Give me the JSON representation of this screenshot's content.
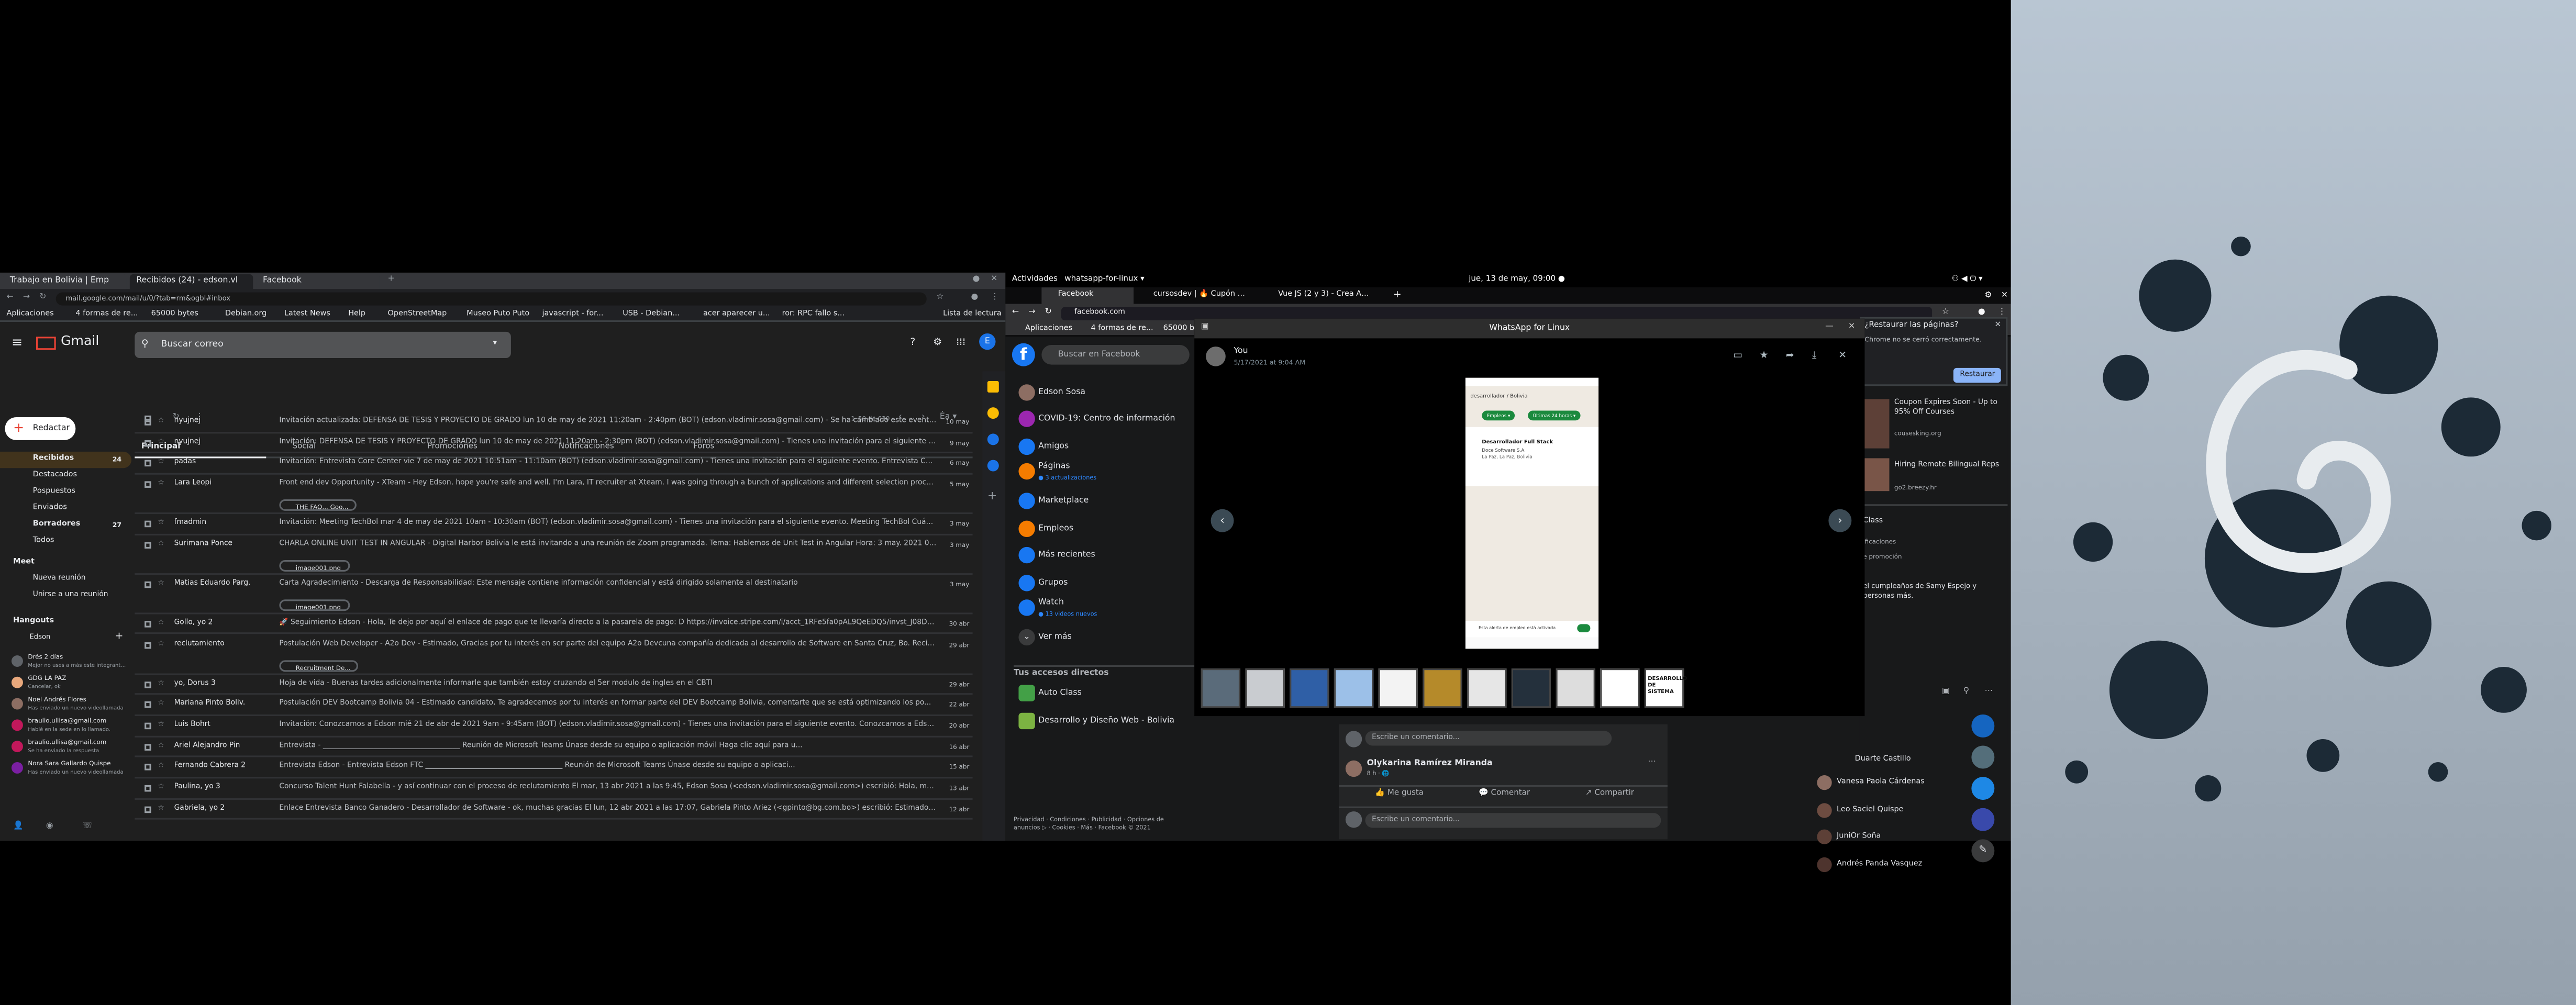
{
  "gmail_window": {
    "tabs": [
      "Trabajo en Bolivia | Emp",
      "Recibidos (24) - edson.vl",
      "Facebook"
    ],
    "url": "mail.google.com/mail/u/0/?tab=rm&ogbl#inbox",
    "bookmarks": [
      "Aplicaciones",
      "4 formas de re...",
      "65000 bytes",
      "Debian.org",
      "Latest News",
      "Help",
      "OpenStreetMap",
      "Museo Puto Puto",
      "javascript - for...",
      "USB - Debian...",
      "acer aparecer u...",
      "ror: RPC fallo s...",
      "Lista de lectura"
    ],
    "app_name": "Gmail",
    "search_placeholder": "Buscar correo",
    "compose": "Redactar",
    "sidebar": [
      {
        "label": "Recibidos",
        "count": "24"
      },
      {
        "label": "Destacados",
        "count": ""
      },
      {
        "label": "Pospuestos",
        "count": ""
      },
      {
        "label": "Enviados",
        "count": ""
      },
      {
        "label": "Borradores",
        "count": "27"
      },
      {
        "label": "Todos",
        "count": ""
      }
    ],
    "meet": {
      "heading": "Meet",
      "new_meeting": "Nueva reunión",
      "join": "Unirse a una reunión"
    },
    "hangouts": {
      "heading": "Hangouts",
      "me": "Edson",
      "contacts": [
        {
          "name": "Drés 2 días",
          "status": "Mejor no uses a más este integrante mi"
        },
        {
          "name": "GDG LA PAZ",
          "status": "Cancelar, ok"
        },
        {
          "name": "Noel Andrés Flores",
          "status": "Has enviado un nuevo videollamada"
        },
        {
          "name": "braulio.ullisa@gmail.com",
          "status": "Hablé en la sede en lo llamado."
        },
        {
          "name": "braulio.ullisa@gmail.com",
          "status": "Se ha enviado la respuesta"
        },
        {
          "name": "Nora Sara Gallardo Quispe",
          "status": "Has enviado un nuevo videollamada"
        }
      ]
    },
    "paging": "1–50 de 630",
    "category_tabs": [
      "Principal",
      "Social",
      "Promociones",
      "Notificaciones",
      "Foros"
    ],
    "emails": [
      {
        "sender": "nyujnej",
        "subject": "Invitación actualizada: DEFENSA DE TESIS Y PROYECTO DE GRADO lun 10 de may de 2021 11:20am - 2:40pm (BOT) (edson.vladimir.sosa@gmail.com) - Se ha cambiado este evento. DEFE...",
        "date": "10 may",
        "attachment": ""
      },
      {
        "sender": "nyujnej",
        "subject": "Invitación: DEFENSA DE TESIS Y PROYECTO DE GRADO lun 10 de may de 2021 11:20am - 2:30pm (BOT) (edson.vladimir.sosa@gmail.com) - Tienes una invitación para el siguiente evento. DEFE...",
        "date": "9 may",
        "attachment": ""
      },
      {
        "sender": "padas",
        "subject": "Invitación: Entrevista Core Center vie 7 de may de 2021 10:51am - 11:10am (BOT) (edson.vladimir.sosa@gmail.com) - Tienes una invitación para el siguiente evento. Entrevista Core Center...",
        "date": "6 may",
        "attachment": ""
      },
      {
        "sender": "Lara Leopi",
        "subject": "Front end dev Opportunity - XTeam - Hey Edson, hope you're safe and well. I'm Lara, IT recruiter at Xteam. I was going through a bunch of applications and different selection processes one...",
        "date": "5 may",
        "attachment": "THE FAQ... Goo..."
      },
      {
        "sender": "fmadmin",
        "subject": "Invitación: Meeting TechBol mar 4 de may de 2021 10am - 10:30am (BOT) (edson.vladimir.sosa@gmail.com) - Tienes una invitación para el siguiente evento. Meeting TechBol Cuándo mar...",
        "date": "3 may",
        "attachment": ""
      },
      {
        "sender": "Surimana Ponce",
        "subject": "CHARLA ONLINE UNIT TEST IN ANGULAR - Digital Harbor Bolivia le está invitando a una reunión de Zoom programada. Tema: Hablemos de Unit Test in Angular Hora: 3 may. 2021 06:30 p...",
        "date": "3 may",
        "attachment": "image001.png"
      },
      {
        "sender": "Matias Eduardo Parg.",
        "subject": "Carta Agradecimiento - Descarga de Responsabilidad: Este mensaje contiene información confidencial y está dirigido solamente al destinatario",
        "date": "3 may",
        "attachment": "image001.png"
      },
      {
        "sender": "Gollo, yo 2",
        "subject": "🚀 Seguimiento Edson - Hola, Te dejo por aquí el enlace de pago que te llevaría directo a la pasarela de pago: D https://invoice.stripe.com/i/acct_1RFe5fa0pAL9QeEDQ5/invst_J08D6e5b...",
        "date": "30 abr",
        "attachment": ""
      },
      {
        "sender": "reclutamiento",
        "subject": "Postulación Web Developer - A2o Dev - Estimado, Gracias por tu interés en ser parte del equipo A2o Devcuna compañía dedicada al desarrollo de Software en Santa Cruz, Bo. Recibimos tu...",
        "date": "29 abr",
        "attachment": "Recruitment De..."
      },
      {
        "sender": "yo, Dorus 3",
        "subject": "Hoja de vida - Buenas tardes adicionalmente informarle que también estoy cruzando el 5er modulo de ingles en el CBTI",
        "date": "29 abr",
        "attachment": ""
      },
      {
        "sender": "Mariana Pinto Boliv.",
        "subject": "Postulación DEV Bootcamp Bolivia 04 - Estimado candidato, Te agradecemos por tu interés en formar parte del DEV Bootcamp Bolivia, comentarte que se está optimizando los po...",
        "date": "22 abr",
        "attachment": ""
      },
      {
        "sender": "Luis Bohrt",
        "subject": "Invitación: Conozcamos a Edson mié 21 de abr de 2021 9am - 9:45am (BOT) (edson.vladimir.sosa@gmail.com) - Tienes una invitación para el siguiente evento. Conozcamos a Edson Cuán...",
        "date": "20 abr",
        "attachment": ""
      },
      {
        "sender": "Ariel Alejandro Pin",
        "subject": "Entrevista - ______________________________________ Reunión de Microsoft Teams Únase desde su equipo o aplicación móvil Haga clic aquí para u...",
        "date": "16 abr",
        "attachment": ""
      },
      {
        "sender": "Fernando Cabrera 2",
        "subject": "Entrevista Edson - Entrevista Edson FTC ______________________________________ Reunión de Microsoft Teams Únase desde su equipo o aplicaci...",
        "date": "15 abr",
        "attachment": ""
      },
      {
        "sender": "Paulina, yo 3",
        "subject": "Concurso Talent Hunt Falabella - y así continuar con el proceso de reclutamiento El mar, 13 abr 2021 a las 9:45, Edson Sosa (<edson.vladimir.sosa@gmail.com>) escribió: Hola, muchas gr...",
        "date": "13 abr",
        "attachment": ""
      },
      {
        "sender": "Gabriela, yo 2",
        "subject": "Enlace Entrevista Banco Ganadero - Desarrollador de Software - ok, muchas gracias El lun, 12 abr 2021 a las 17:07, Gabriela Pinto Ariez (<gpinto@bg.com.bo>) escribió: Estimado Edson...",
        "date": "12 abr",
        "attachment": ""
      }
    ]
  },
  "gnome_bar": {
    "activities": "Actividades",
    "app": "whatsapp-for-linux ▾",
    "clock": "jue, 13 de may, 09:00 ●"
  },
  "firefox_window": {
    "tabs": [
      "Facebook",
      "cursosdev | 🔥 Cupón U...",
      "Vue JS (2 y 3) - Crea Aplic..."
    ],
    "url": "facebook.com",
    "bookmarks": [
      "Aplicaciones",
      "4 formas de re...",
      "65000 b"
    ],
    "restore": {
      "question": "¿Restaurar las páginas?",
      "detail": "Chrome no se cerró correctamente.",
      "button": "Restaurar"
    },
    "fb_search": "Buscar en Facebook",
    "left_menu": [
      {
        "label": "Edson Sosa",
        "sub": ""
      },
      {
        "label": "COVID-19: Centro de información",
        "sub": ""
      },
      {
        "label": "Amigos",
        "sub": ""
      },
      {
        "label": "Páginas",
        "sub": "● 3 actualizaciones"
      },
      {
        "label": "Marketplace",
        "sub": ""
      },
      {
        "label": "Empleos",
        "sub": ""
      },
      {
        "label": "Más recientes",
        "sub": ""
      },
      {
        "label": "Grupos",
        "sub": ""
      },
      {
        "label": "Watch",
        "sub": "● 13 videos nuevos"
      },
      {
        "label": "Ver más",
        "sub": ""
      }
    ],
    "shortcuts_heading": "Tus accesos directos",
    "shortcuts": [
      "Auto Class",
      "Desarrollo y Diseño Web - Bolivia"
    ],
    "footer": "Privacidad · Condiciones · Publicidad · Opciones de anuncios ▷ · Cookies · Más · Facebook © 2021",
    "ads": [
      {
        "title": "Coupon Expires Soon - Up to 95% Off Courses",
        "site": "cousesking.org"
      },
      {
        "title": "Hiring Remote Bilingual Reps",
        "site": "go2.breezy.hr"
      }
    ],
    "right_misc": [
      "Class",
      "ificaciones",
      "e promoción"
    ],
    "birthday": "el cumpleaños de Samy Espejo y personas más.",
    "contacts": [
      "Duarte Castillo",
      "Vanesa Paola Cárdenas",
      "Leo Saciel Quispe",
      "JuniOr Soña",
      "Andrés Panda Vasquez"
    ],
    "post": {
      "author": "Olykarina Ramírez Miranda",
      "time": "8 h · 🌐",
      "like": "Me gusta",
      "comment": "Comentar",
      "share": "Compartir",
      "comment_placeholder": "Escribe un comentario..."
    }
  },
  "whatsapp_viewer": {
    "title": "WhatsApp for Linux",
    "sender": "You",
    "timestamp": "5/17/2021 at 9:04 AM",
    "image": {
      "header": "desarrollador / Bolivia",
      "filters": [
        "Empleos ▾",
        "Últimas 24 horas ▾"
      ],
      "job_title": "Desarrollador Full Stack",
      "company": "Doce Software S.A.",
      "location": "La Paz, La Paz, Bolivia",
      "alert": "Esta alerta de empleo está activada"
    },
    "thumbnail_count": 10,
    "last_thumb_text": "DESARROLLO DE SISTEMA"
  }
}
